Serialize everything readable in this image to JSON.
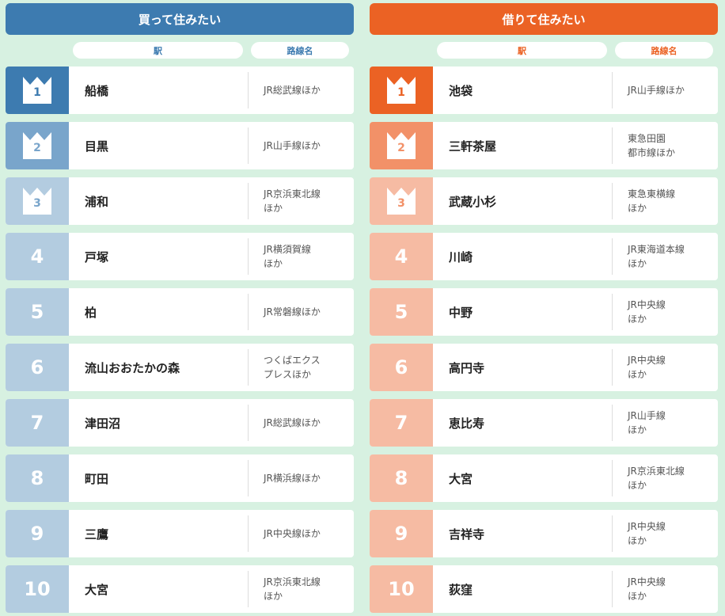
{
  "buy": {
    "title": "買って住みたい",
    "col_station": "駅",
    "col_line": "路線名",
    "colors": {
      "header": "#3d7bb0",
      "rank1": "#3d7bb0",
      "rank2": "#79a5cb",
      "rank3": "#b3cce0",
      "rank_rest": "#b3cce0",
      "pill_text": "#3d7bb0"
    },
    "rows": [
      {
        "rank": "1",
        "station": "船橋",
        "line": [
          "JR総武線ほか"
        ]
      },
      {
        "rank": "2",
        "station": "目黒",
        "line": [
          "JR山手線ほか"
        ]
      },
      {
        "rank": "3",
        "station": "浦和",
        "line": [
          "JR京浜東北線",
          "ほか"
        ]
      },
      {
        "rank": "4",
        "station": "戸塚",
        "line": [
          "JR横須賀線",
          "ほか"
        ]
      },
      {
        "rank": "5",
        "station": "柏",
        "line": [
          "JR常磐線ほか"
        ]
      },
      {
        "rank": "6",
        "station": "流山おおたかの森",
        "line": [
          "つくばエクス",
          "プレスほか"
        ]
      },
      {
        "rank": "7",
        "station": "津田沼",
        "line": [
          "JR総武線ほか"
        ]
      },
      {
        "rank": "8",
        "station": "町田",
        "line": [
          "JR横浜線ほか"
        ]
      },
      {
        "rank": "9",
        "station": "三鷹",
        "line": [
          "JR中央線ほか"
        ]
      },
      {
        "rank": "10",
        "station": "大宮",
        "line": [
          "JR京浜東北線",
          "ほか"
        ]
      }
    ]
  },
  "rent": {
    "title": "借りて住みたい",
    "col_station": "駅",
    "col_line": "路線名",
    "colors": {
      "header": "#eb6224",
      "rank1": "#eb6224",
      "rank2": "#f29168",
      "rank3": "#f6bba3",
      "rank_rest": "#f6bba3",
      "pill_text": "#eb6224"
    },
    "rows": [
      {
        "rank": "1",
        "station": "池袋",
        "line": [
          "JR山手線ほか"
        ]
      },
      {
        "rank": "2",
        "station": "三軒茶屋",
        "line": [
          "東急田園",
          "都市線ほか"
        ]
      },
      {
        "rank": "3",
        "station": "武蔵小杉",
        "line": [
          "東急東横線",
          "ほか"
        ]
      },
      {
        "rank": "4",
        "station": "川崎",
        "line": [
          "JR東海道本線",
          "ほか"
        ]
      },
      {
        "rank": "5",
        "station": "中野",
        "line": [
          "JR中央線",
          "ほか"
        ]
      },
      {
        "rank": "6",
        "station": "高円寺",
        "line": [
          "JR中央線",
          "ほか"
        ]
      },
      {
        "rank": "7",
        "station": "恵比寿",
        "line": [
          "JR山手線",
          "ほか"
        ]
      },
      {
        "rank": "8",
        "station": "大宮",
        "line": [
          "JR京浜東北線",
          "ほか"
        ]
      },
      {
        "rank": "9",
        "station": "吉祥寺",
        "line": [
          "JR中央線",
          "ほか"
        ]
      },
      {
        "rank": "10",
        "station": "荻窪",
        "line": [
          "JR中央線",
          "ほか"
        ]
      }
    ]
  },
  "icons": {
    "top3": "crown-icon"
  }
}
